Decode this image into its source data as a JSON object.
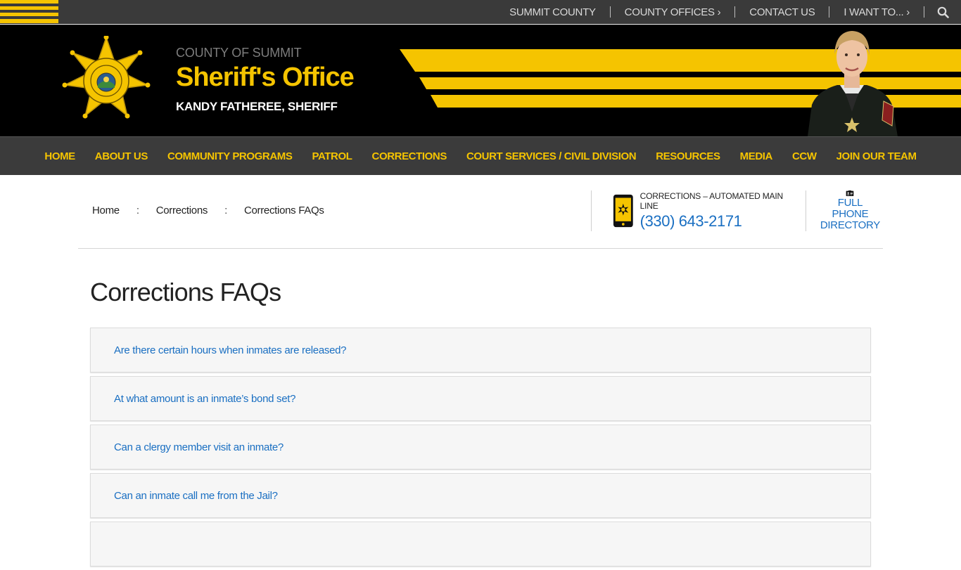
{
  "utility_nav": {
    "links": [
      {
        "label": "SUMMIT COUNTY"
      },
      {
        "label": "COUNTY OFFICES ›"
      },
      {
        "label": "CONTACT US"
      },
      {
        "label": "I WANT TO... ›"
      }
    ],
    "search_icon": "search-icon"
  },
  "header": {
    "county_of": "COUNTY OF SUMMIT",
    "office_title": "Sheriff's Office",
    "sheriff_name": "KANDY FATHEREE, SHERIFF",
    "badge": {
      "top_text": "KANDY FATHEREE",
      "mid_text": "SHERIFF",
      "state_text": "STATE OF",
      "state_small": "OHIO",
      "bottom_text": "SUMMIT COUNTY"
    },
    "colors": {
      "accent": "#f5c400",
      "background": "#000000"
    }
  },
  "main_nav": {
    "items": [
      {
        "label": "HOME"
      },
      {
        "label": "ABOUT US"
      },
      {
        "label": "COMMUNITY PROGRAMS"
      },
      {
        "label": "PATROL"
      },
      {
        "label": "CORRECTIONS"
      },
      {
        "label": "COURT SERVICES / CIVIL DIVISION"
      },
      {
        "label": "RESOURCES"
      },
      {
        "label": "MEDIA"
      },
      {
        "label": "CCW"
      },
      {
        "label": "JOIN OUR TEAM"
      }
    ]
  },
  "breadcrumb": {
    "items": [
      {
        "label": "Home"
      },
      {
        "label": "Corrections"
      },
      {
        "label": "Corrections FAQs"
      }
    ],
    "separator": ":"
  },
  "contact": {
    "phone_label": "CORRECTIONS – AUTOMATED MAIN LINE",
    "phone_number": "(330) 643-2171",
    "directory_label_1": "FULL PHONE",
    "directory_label_2": "DIRECTORY"
  },
  "page": {
    "title": "Corrections FAQs"
  },
  "faqs": [
    {
      "question": "Are there certain hours when inmates are released?"
    },
    {
      "question": "At what amount is an inmate’s bond set?"
    },
    {
      "question": "Can a clergy member visit an inmate?"
    },
    {
      "question": "Can an inmate call me from the Jail?"
    },
    {
      "question": ""
    }
  ],
  "colors": {
    "link_blue": "#1a6fc2",
    "nav_bg": "#3b3b3b",
    "gold": "#f5c400"
  }
}
